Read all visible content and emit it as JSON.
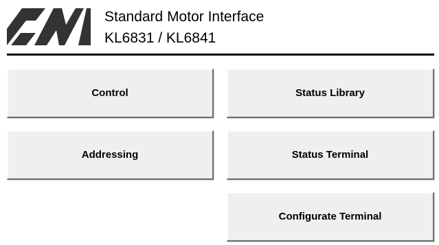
{
  "header": {
    "title": "Standard Motor Interface",
    "subtitle": "KL6831 / KL6841",
    "logo_icon": "smi-logo-icon"
  },
  "buttons": {
    "control": "Control",
    "addressing": "Addressing",
    "status_library": "Status Library",
    "status_terminal": "Status Terminal",
    "configurate_terminal": "Configurate Terminal"
  },
  "colors": {
    "button_face": "#efefef",
    "button_shadow": "#6e6e6e",
    "rule": "#000000"
  }
}
